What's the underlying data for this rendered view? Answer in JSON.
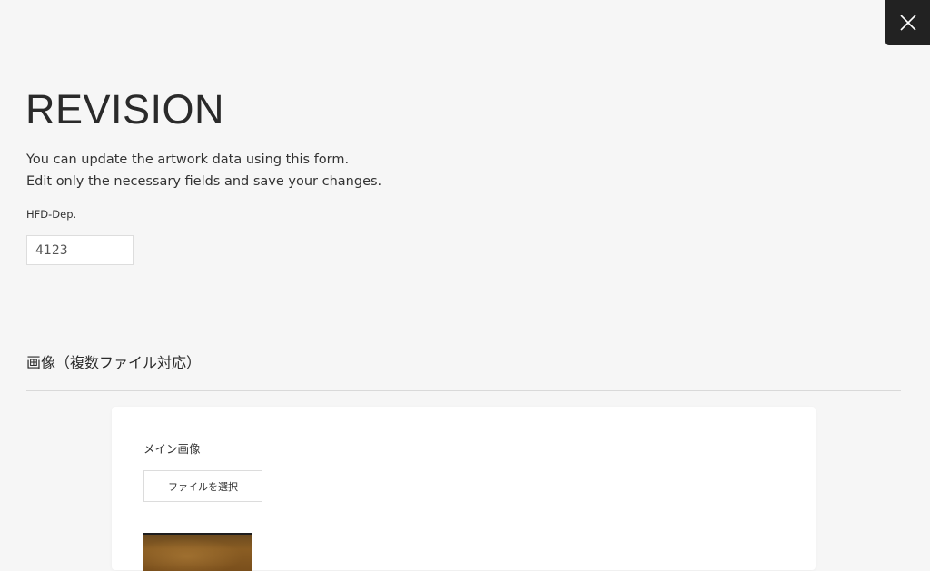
{
  "close_button": {
    "icon": "close-icon"
  },
  "page": {
    "title": "REVISION",
    "intro_lines": [
      "You can update the artwork data using this form.",
      "Edit only the necessary fields and save your changes."
    ]
  },
  "fields": {
    "hfd_dep": {
      "label": "HFD-Dep.",
      "value": "4123"
    }
  },
  "images_section": {
    "title": "画像（複数ファイル対応）",
    "main_image": {
      "label": "メイン画像",
      "file_button_label": "ファイルを選択"
    }
  },
  "colors": {
    "background": "#f6f6f6",
    "close_button_bg": "#222222",
    "card_bg": "#ffffff"
  }
}
